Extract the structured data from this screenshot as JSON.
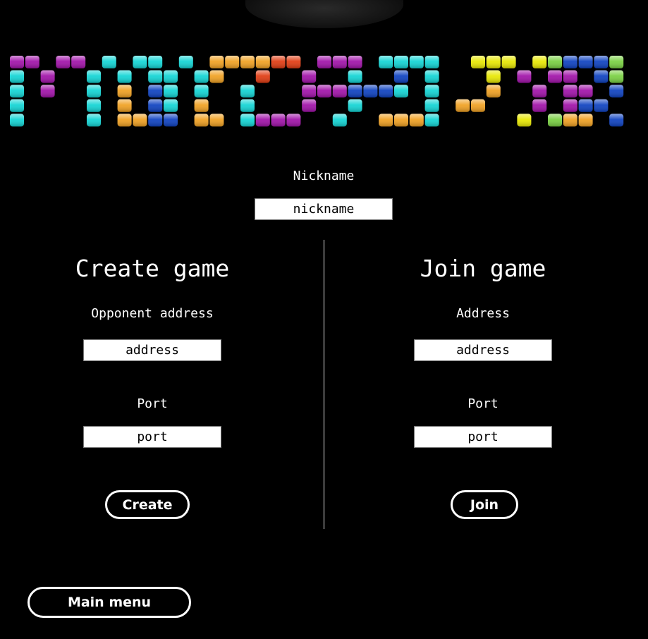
{
  "logo": {
    "title": "MULTIPLAYER",
    "colors": {
      "P": "#a010a8",
      "C": "#10d4d4",
      "O": "#f0a020",
      "B": "#0c40c0",
      "R": "#e03a10",
      "Y": "#e8e800",
      "G": "#78d040"
    }
  },
  "nickname": {
    "label": "Nickname",
    "placeholder": "nickname"
  },
  "create": {
    "heading": "Create game",
    "address_label": "Opponent address",
    "address_placeholder": "address",
    "port_label": "Port",
    "port_placeholder": "port",
    "button": "Create"
  },
  "join": {
    "heading": "Join game",
    "address_label": "Address",
    "address_placeholder": "address",
    "port_label": "Port",
    "port_placeholder": "port",
    "button": "Join"
  },
  "main_menu_button": "Main menu"
}
